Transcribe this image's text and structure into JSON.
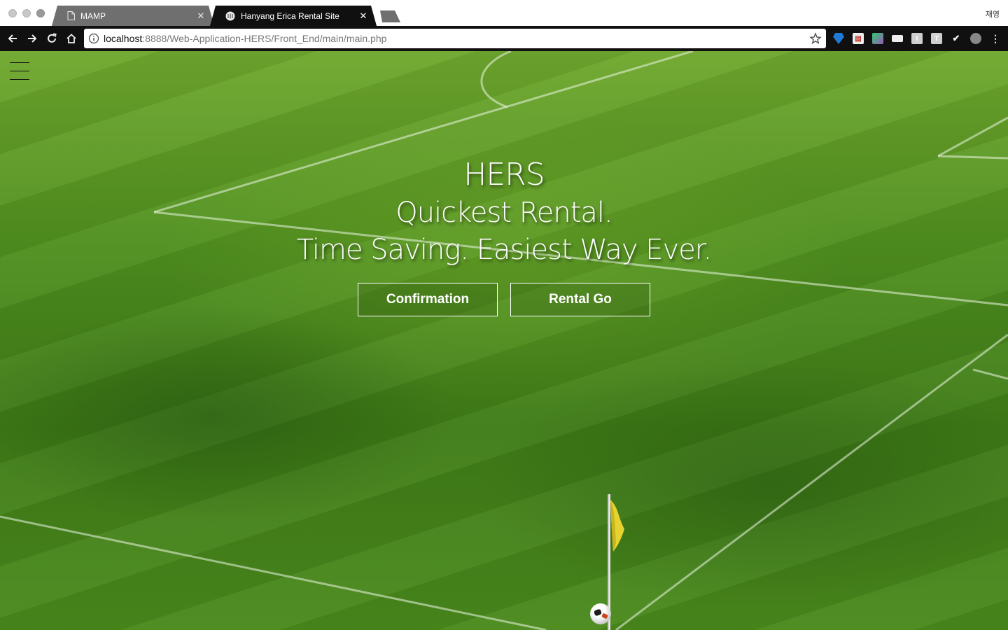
{
  "browser": {
    "tabs": [
      {
        "title": "MAMP",
        "icon": "document-icon",
        "active": false
      },
      {
        "title": "Hanyang Erica Rental Site",
        "icon": "site-favicon",
        "active": true
      }
    ],
    "profile": "재영",
    "url": {
      "host": "localhost",
      "rest": ":8888/Web-Application-HERS/Front_End/main/main.php"
    }
  },
  "hero": {
    "line1": "HERS",
    "line2": "Quickest Rental.",
    "line3": "Time Saving. Easiest Way Ever."
  },
  "buttons": {
    "confirmation": "Confirmation",
    "rental_go": "Rental Go"
  },
  "colors": {
    "turf": "#4e8e1e",
    "flag": "#e6d230",
    "chrome_dark": "#101010"
  }
}
